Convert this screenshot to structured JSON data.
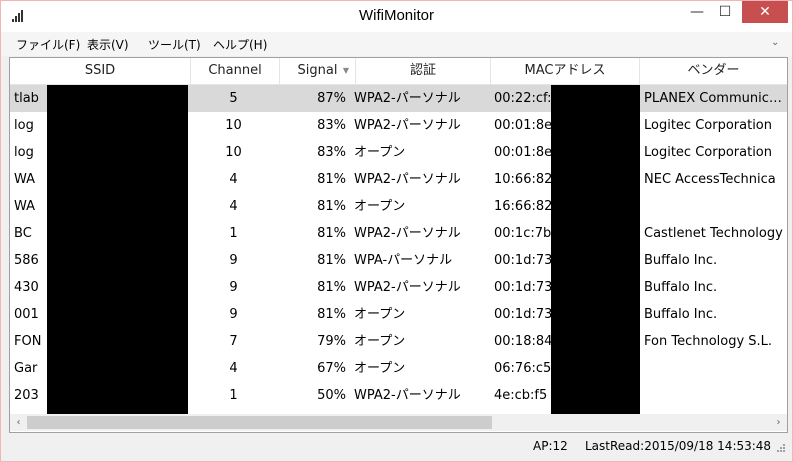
{
  "window": {
    "title": "WifiMonitor",
    "controls": {
      "minimize": "—",
      "maximize": "☐",
      "close": "✕"
    }
  },
  "menu": {
    "items": [
      "ファイル(F)",
      "表示(V)",
      "ツール(T)",
      "ヘルプ(H)"
    ],
    "collapse": "⌄"
  },
  "table": {
    "columns": [
      "SSID",
      "Channel",
      "Signal",
      "認証",
      "MACアドレス",
      "ベンダー"
    ],
    "sorted_column": "Signal",
    "sort_indicator": "▼",
    "rows": [
      {
        "ssid": "tlab",
        "channel": "5",
        "signal": "87%",
        "auth": "WPA2-パーソナル",
        "mac": "00:22:cf:",
        "vendor": "PLANEX Communications",
        "selected": true
      },
      {
        "ssid": "log",
        "channel": "10",
        "signal": "83%",
        "auth": "WPA2-パーソナル",
        "mac": "00:01:8e",
        "vendor": "Logitec Corporation"
      },
      {
        "ssid": "log",
        "channel": "10",
        "signal": "83%",
        "auth": "オープン",
        "mac": "00:01:8e",
        "vendor": "Logitec Corporation"
      },
      {
        "ssid": "WA",
        "channel": "4",
        "signal": "81%",
        "auth": "WPA2-パーソナル",
        "mac": "10:66:82",
        "vendor": "NEC AccessTechnica"
      },
      {
        "ssid": "WA",
        "channel": "4",
        "signal": "81%",
        "auth": "オープン",
        "mac": "16:66:82",
        "vendor": ""
      },
      {
        "ssid": "BC",
        "channel": "1",
        "signal": "81%",
        "auth": "WPA2-パーソナル",
        "mac": "00:1c:7b",
        "vendor": "Castlenet Technology"
      },
      {
        "ssid": "586",
        "channel": "9",
        "signal": "81%",
        "auth": "WPA-パーソナル",
        "mac": "00:1d:73",
        "vendor": "Buffalo Inc."
      },
      {
        "ssid": "430",
        "channel": "9",
        "signal": "81%",
        "auth": "WPA2-パーソナル",
        "mac": "00:1d:73",
        "vendor": "Buffalo Inc."
      },
      {
        "ssid": "001",
        "channel": "9",
        "signal": "81%",
        "auth": "オープン",
        "mac": "00:1d:73",
        "vendor": "Buffalo Inc."
      },
      {
        "ssid": "FON",
        "channel": "7",
        "signal": "79%",
        "auth": "オープン",
        "mac": "00:18:84",
        "vendor": "Fon Technology S.L."
      },
      {
        "ssid": "Gar",
        "channel": "4",
        "signal": "67%",
        "auth": "オープン",
        "mac": "06:76:c5",
        "vendor": ""
      },
      {
        "ssid": "203",
        "channel": "1",
        "signal": "50%",
        "auth": "WPA2-パーソナル",
        "mac": "4e:cb:f5",
        "vendor": ""
      }
    ]
  },
  "scrollbar": {
    "left_arrow": "‹",
    "right_arrow": "›"
  },
  "status": {
    "ap_count": "AP:12",
    "last_read": "LastRead:2015/09/18 14:53:48"
  },
  "colors": {
    "selected_row": "#d9d9d9",
    "close_button": "#c74f4f",
    "window_border": "#f2b4b4"
  }
}
